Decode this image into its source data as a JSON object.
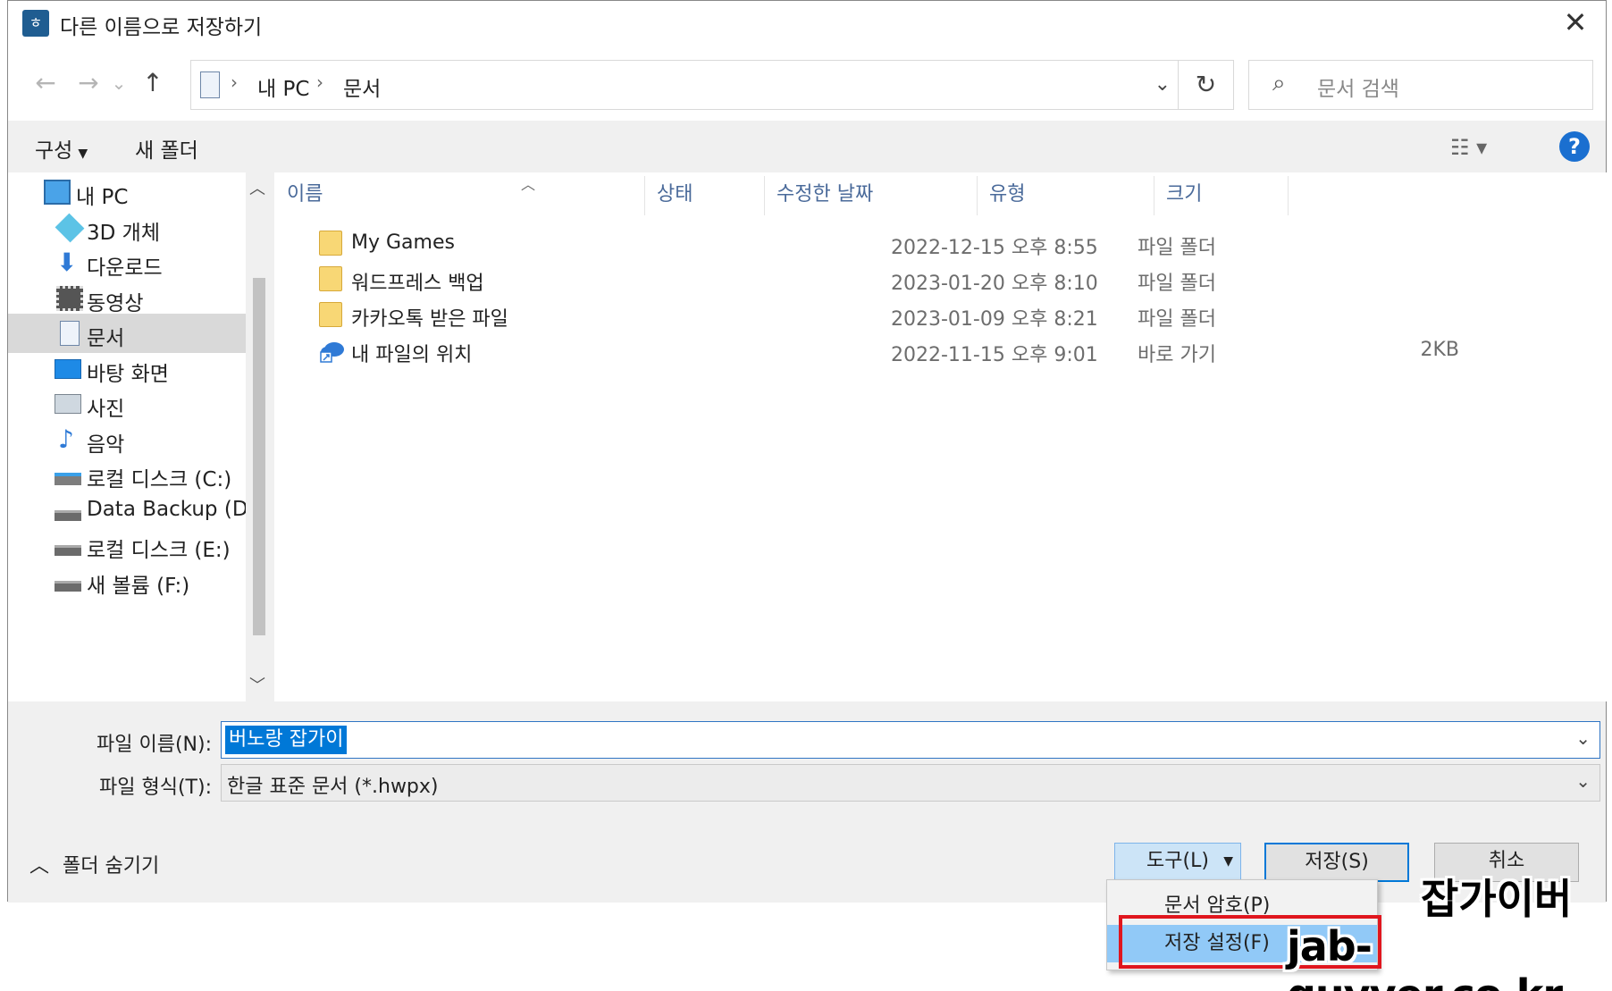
{
  "window": {
    "title": "다른 이름으로 저장하기",
    "close": "✕"
  },
  "nav": {
    "back": "←",
    "forward": "→",
    "recent": "⌄",
    "up": "↑",
    "breadcrumbs": [
      "내 PC",
      "문서"
    ],
    "separator": "›",
    "search_placeholder": "문서 검색"
  },
  "toolbar": {
    "organize": "구성",
    "new_folder": "새 폴더"
  },
  "sidebar": {
    "items": [
      {
        "label": "내 PC",
        "icon": "computer-icon"
      },
      {
        "label": "3D 개체",
        "icon": "cube-icon"
      },
      {
        "label": "다운로드",
        "icon": "download-icon"
      },
      {
        "label": "동영상",
        "icon": "video-icon"
      },
      {
        "label": "문서",
        "icon": "document-icon",
        "selected": true
      },
      {
        "label": "바탕 화면",
        "icon": "desktop-icon"
      },
      {
        "label": "사진",
        "icon": "picture-icon"
      },
      {
        "label": "음악",
        "icon": "music-icon"
      },
      {
        "label": "로컬 디스크 (C:)",
        "icon": "system-drive-icon"
      },
      {
        "label": "Data Backup (D",
        "icon": "drive-icon"
      },
      {
        "label": "로컬 디스크 (E:)",
        "icon": "drive-icon"
      },
      {
        "label": "새 볼륨 (F:)",
        "icon": "drive-icon"
      }
    ]
  },
  "columns": {
    "name": "이름",
    "status": "상태",
    "modified": "수정한 날짜",
    "type": "유형",
    "size": "크기"
  },
  "files": [
    {
      "name": "My Games",
      "date": "2022-12-15 오후 8:55",
      "type": "파일 폴더",
      "size": "",
      "icon": "folder-icon"
    },
    {
      "name": "워드프레스 백업",
      "date": "2023-01-20 오후 8:10",
      "type": "파일 폴더",
      "size": "",
      "icon": "folder-icon"
    },
    {
      "name": "카카오톡 받은 파일",
      "date": "2023-01-09 오후 8:21",
      "type": "파일 폴더",
      "size": "",
      "icon": "folder-icon"
    },
    {
      "name": "내 파일의 위치",
      "date": "2022-11-15 오후 9:01",
      "type": "바로 가기",
      "size": "2KB",
      "icon": "cloud-shortcut-icon"
    }
  ],
  "form": {
    "filename_label": "파일 이름(N):",
    "filename_value": "버노랑 잡가이",
    "filetype_label": "파일 형식(T):",
    "filetype_value": "한글 표준 문서 (*.hwpx)",
    "hide_folders": "폴더 숨기기"
  },
  "buttons": {
    "tools": "도구(L)",
    "save": "저장(S)",
    "cancel": "취소"
  },
  "tools_menu": [
    "문서 암호(P)",
    "저장 설정(F)"
  ],
  "watermark": {
    "line1": "잡가이버",
    "line2": "jab-guyver.co.kr"
  },
  "colors": {
    "accent": "#0078d7",
    "highlight_box": "#e0161e",
    "menu_hover": "#91c9f7"
  }
}
